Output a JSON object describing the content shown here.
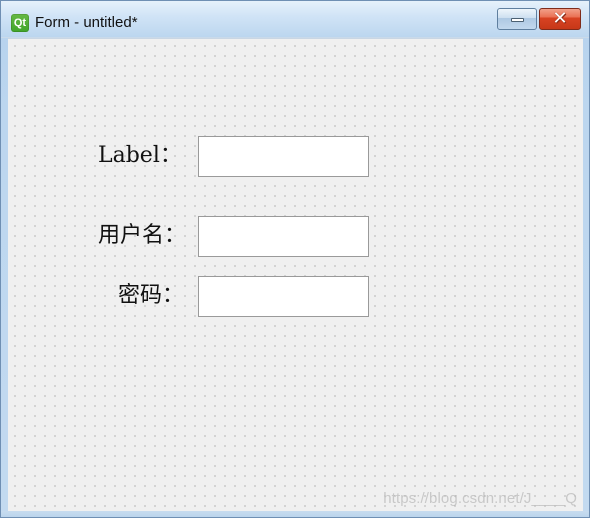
{
  "window": {
    "title": "Form - untitled*",
    "icon_text": "Qt",
    "controls": {
      "minimize_icon": "minimize-icon",
      "close_icon": "close-icon",
      "close_symbol": "✕"
    }
  },
  "form": {
    "fields": [
      {
        "label": "Label：",
        "value": ""
      },
      {
        "label": "用户名：",
        "value": ""
      },
      {
        "label": "密码：",
        "value": ""
      }
    ]
  },
  "watermark": "https://blog.csdn.net/J____Q",
  "colors": {
    "qt_green": "#41a52a",
    "close_red": "#d84323",
    "canvas_bg": "#f0f0f0"
  }
}
